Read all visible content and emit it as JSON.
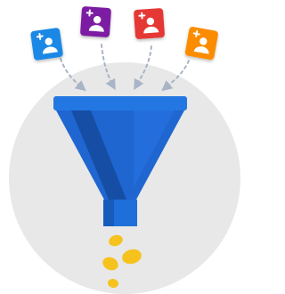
{
  "illustration": {
    "subject": "lead-funnel",
    "icons": [
      "add-user-icon",
      "funnel-icon",
      "coin-icon"
    ],
    "colors": {
      "background_circle": "#e8e8e8",
      "card_blue": "#1e88e5",
      "card_purple": "#7b1fa2",
      "card_red": "#e53935",
      "card_orange": "#fb8c00",
      "funnel_rim": "#2377e2",
      "funnel_body": "#1f66d1",
      "funnel_shadow": "#154a9f",
      "funnel_spout": "#1e6fd9",
      "coin": "#f6c21d",
      "arrow": "#a9b4c6"
    }
  }
}
